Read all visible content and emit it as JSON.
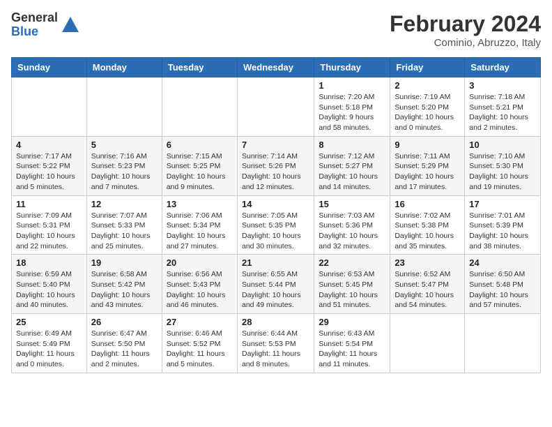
{
  "header": {
    "logo_general": "General",
    "logo_blue": "Blue",
    "month_year": "February 2024",
    "location": "Cominio, Abruzzo, Italy"
  },
  "weekdays": [
    "Sunday",
    "Monday",
    "Tuesday",
    "Wednesday",
    "Thursday",
    "Friday",
    "Saturday"
  ],
  "weeks": [
    [
      {
        "day": "",
        "info": ""
      },
      {
        "day": "",
        "info": ""
      },
      {
        "day": "",
        "info": ""
      },
      {
        "day": "",
        "info": ""
      },
      {
        "day": "1",
        "info": "Sunrise: 7:20 AM\nSunset: 5:18 PM\nDaylight: 9 hours\nand 58 minutes."
      },
      {
        "day": "2",
        "info": "Sunrise: 7:19 AM\nSunset: 5:20 PM\nDaylight: 10 hours\nand 0 minutes."
      },
      {
        "day": "3",
        "info": "Sunrise: 7:18 AM\nSunset: 5:21 PM\nDaylight: 10 hours\nand 2 minutes."
      }
    ],
    [
      {
        "day": "4",
        "info": "Sunrise: 7:17 AM\nSunset: 5:22 PM\nDaylight: 10 hours\nand 5 minutes."
      },
      {
        "day": "5",
        "info": "Sunrise: 7:16 AM\nSunset: 5:23 PM\nDaylight: 10 hours\nand 7 minutes."
      },
      {
        "day": "6",
        "info": "Sunrise: 7:15 AM\nSunset: 5:25 PM\nDaylight: 10 hours\nand 9 minutes."
      },
      {
        "day": "7",
        "info": "Sunrise: 7:14 AM\nSunset: 5:26 PM\nDaylight: 10 hours\nand 12 minutes."
      },
      {
        "day": "8",
        "info": "Sunrise: 7:12 AM\nSunset: 5:27 PM\nDaylight: 10 hours\nand 14 minutes."
      },
      {
        "day": "9",
        "info": "Sunrise: 7:11 AM\nSunset: 5:29 PM\nDaylight: 10 hours\nand 17 minutes."
      },
      {
        "day": "10",
        "info": "Sunrise: 7:10 AM\nSunset: 5:30 PM\nDaylight: 10 hours\nand 19 minutes."
      }
    ],
    [
      {
        "day": "11",
        "info": "Sunrise: 7:09 AM\nSunset: 5:31 PM\nDaylight: 10 hours\nand 22 minutes."
      },
      {
        "day": "12",
        "info": "Sunrise: 7:07 AM\nSunset: 5:33 PM\nDaylight: 10 hours\nand 25 minutes."
      },
      {
        "day": "13",
        "info": "Sunrise: 7:06 AM\nSunset: 5:34 PM\nDaylight: 10 hours\nand 27 minutes."
      },
      {
        "day": "14",
        "info": "Sunrise: 7:05 AM\nSunset: 5:35 PM\nDaylight: 10 hours\nand 30 minutes."
      },
      {
        "day": "15",
        "info": "Sunrise: 7:03 AM\nSunset: 5:36 PM\nDaylight: 10 hours\nand 32 minutes."
      },
      {
        "day": "16",
        "info": "Sunrise: 7:02 AM\nSunset: 5:38 PM\nDaylight: 10 hours\nand 35 minutes."
      },
      {
        "day": "17",
        "info": "Sunrise: 7:01 AM\nSunset: 5:39 PM\nDaylight: 10 hours\nand 38 minutes."
      }
    ],
    [
      {
        "day": "18",
        "info": "Sunrise: 6:59 AM\nSunset: 5:40 PM\nDaylight: 10 hours\nand 40 minutes."
      },
      {
        "day": "19",
        "info": "Sunrise: 6:58 AM\nSunset: 5:42 PM\nDaylight: 10 hours\nand 43 minutes."
      },
      {
        "day": "20",
        "info": "Sunrise: 6:56 AM\nSunset: 5:43 PM\nDaylight: 10 hours\nand 46 minutes."
      },
      {
        "day": "21",
        "info": "Sunrise: 6:55 AM\nSunset: 5:44 PM\nDaylight: 10 hours\nand 49 minutes."
      },
      {
        "day": "22",
        "info": "Sunrise: 6:53 AM\nSunset: 5:45 PM\nDaylight: 10 hours\nand 51 minutes."
      },
      {
        "day": "23",
        "info": "Sunrise: 6:52 AM\nSunset: 5:47 PM\nDaylight: 10 hours\nand 54 minutes."
      },
      {
        "day": "24",
        "info": "Sunrise: 6:50 AM\nSunset: 5:48 PM\nDaylight: 10 hours\nand 57 minutes."
      }
    ],
    [
      {
        "day": "25",
        "info": "Sunrise: 6:49 AM\nSunset: 5:49 PM\nDaylight: 11 hours\nand 0 minutes."
      },
      {
        "day": "26",
        "info": "Sunrise: 6:47 AM\nSunset: 5:50 PM\nDaylight: 11 hours\nand 2 minutes."
      },
      {
        "day": "27",
        "info": "Sunrise: 6:46 AM\nSunset: 5:52 PM\nDaylight: 11 hours\nand 5 minutes."
      },
      {
        "day": "28",
        "info": "Sunrise: 6:44 AM\nSunset: 5:53 PM\nDaylight: 11 hours\nand 8 minutes."
      },
      {
        "day": "29",
        "info": "Sunrise: 6:43 AM\nSunset: 5:54 PM\nDaylight: 11 hours\nand 11 minutes."
      },
      {
        "day": "",
        "info": ""
      },
      {
        "day": "",
        "info": ""
      }
    ]
  ]
}
